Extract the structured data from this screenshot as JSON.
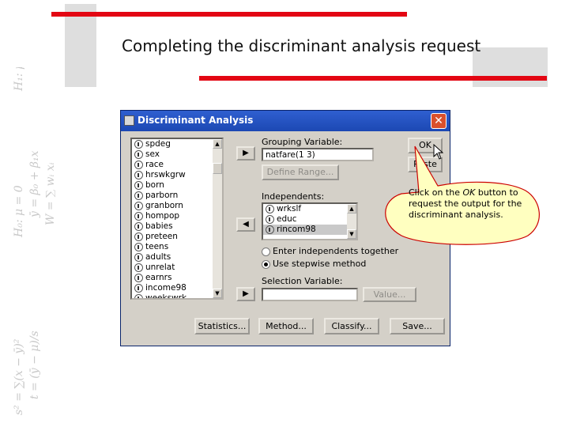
{
  "slide": {
    "title": "Completing the discriminant analysis request"
  },
  "decor": {
    "formula_lines": [
      "H₁: μ < 0",
      "ȳ = β₀ + β₁x",
      "W = ∑ wᵢ xᵢ",
      "H₀: μ = 0",
      "t = (ȳ − μ)/s",
      "s² = ∑(x − ȳ)²"
    ],
    "colors": {
      "red_bar": "#e30613",
      "gray_block": "#dedede"
    }
  },
  "dialog": {
    "title": "Discriminant Analysis",
    "close_label": "✕",
    "variables": [
      "spdeg",
      "sex",
      "race",
      "hrswkgrw",
      "born",
      "parborn",
      "granborn",
      "hompop",
      "babies",
      "preteen",
      "teens",
      "adults",
      "unrelat",
      "earnrs",
      "income98",
      "weekswrk"
    ],
    "grouping_label": "Grouping Variable:",
    "grouping_value": "natfare(1 3)",
    "define_range_label": "Define Range...",
    "independents_label": "Independents:",
    "independents": [
      "wrkslf",
      "educ",
      "rincom98"
    ],
    "enter_together_label": "Enter independents together",
    "stepwise_label": "Use stepwise method",
    "selection_label": "Selection Variable:",
    "selection_value": "",
    "value_button": "Value...",
    "ok_label": "OK",
    "paste_label": "Paste",
    "move_right_glyph": "▶",
    "move_left_glyph": "◀",
    "footer_buttons": {
      "statistics": "Statistics...",
      "method": "Method...",
      "classify": "Classify...",
      "save": "Save..."
    }
  },
  "callout": {
    "text_before": "Click on the ",
    "text_emph": "OK",
    "text_after": " button to request the output for the discriminant analysis.",
    "fill": "#ffffc0",
    "stroke": "#cc0000"
  }
}
